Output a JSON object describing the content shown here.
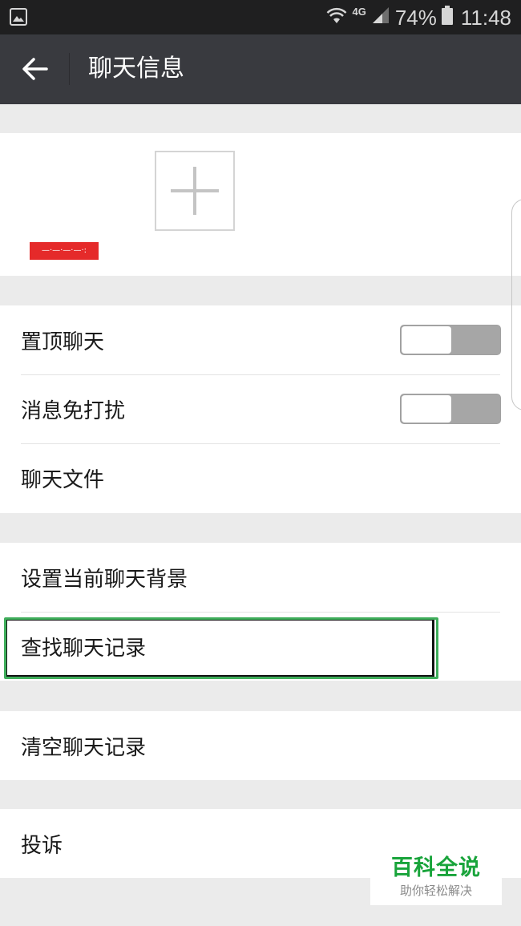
{
  "status_bar": {
    "network_label": "4G",
    "battery": "74%",
    "time": "11:48"
  },
  "header": {
    "title": "聊天信息"
  },
  "members": {
    "first_member_name": "—·—·—·—·:"
  },
  "settings": {
    "pin_chat": {
      "label": "置顶聊天",
      "on": false
    },
    "mute_notifications": {
      "label": "消息免打扰",
      "on": false
    },
    "chat_files": {
      "label": "聊天文件"
    }
  },
  "chat_options": {
    "set_background": "设置当前聊天背景",
    "search_history": "查找聊天记录"
  },
  "clear_history": "清空聊天记录",
  "report": "投诉",
  "watermark": {
    "title": "百科全说",
    "subtitle": "助你轻松解决"
  },
  "colors": {
    "status_bar": "#1f1f20",
    "title_bar": "#393a3f",
    "page_bg": "#ebebeb",
    "highlight_green": "#3fae5b",
    "watermark_green": "#19a43b"
  }
}
